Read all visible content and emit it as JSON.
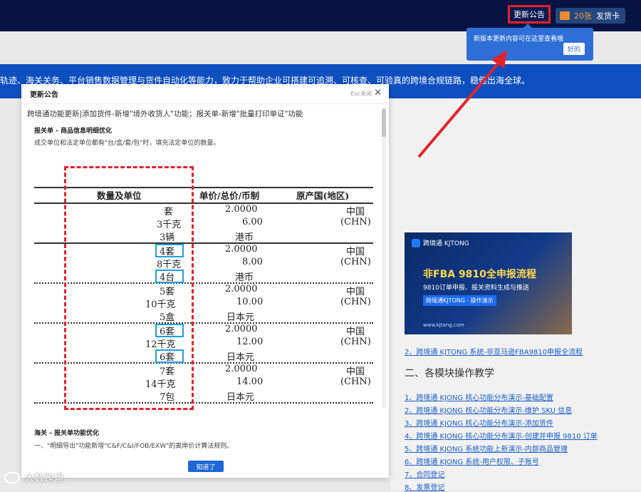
{
  "topbar": {
    "notice_label": "更新公告",
    "ticket_count": "20张",
    "ticket_label": "发货卡"
  },
  "tooltip": {
    "text": "新版本更新内容可在这里查看哦",
    "ok": "好的"
  },
  "banner": {
    "text": "轨迹、海关关务、平台销售数据管理与货件自动化等能力，致力于帮助企业可搭建可追溯、可核查、可验真的跨境合规链路，稳健出海全球。"
  },
  "dialog": {
    "title": "更新公告",
    "esc": "Esc关闭",
    "headline": "跨境通功能更新|添加货件-新增\"境外收货人\"功能；报关单-新增\"批量打印单证\"功能",
    "section1_title": "报关单 - 商品信息明细优化",
    "section1_desc": "成交单位和法定单位都有\"台/盒/套/包\"时，填充法定单位的数量。",
    "table": {
      "headers": [
        "数量及单位",
        "单价/总价/币制",
        "原产国(地区)"
      ],
      "groups": [
        {
          "qty": [
            "套",
            "3千克",
            "3辆"
          ],
          "price": [
            "2.0000",
            "6.00",
            "港币"
          ],
          "origin": [
            "中国",
            "(CHN)"
          ]
        },
        {
          "qty": [
            "4套",
            "8千克",
            "4台"
          ],
          "price": [
            "2.0000",
            "8.00",
            "港币"
          ],
          "origin": [
            "中国",
            "(CHN)"
          ]
        },
        {
          "qty": [
            "5套",
            "10千克",
            "5盒"
          ],
          "price": [
            "2.0000",
            "10.00",
            "日本元"
          ],
          "origin": [
            "中国",
            "(CHN)"
          ]
        },
        {
          "qty": [
            "6套",
            "12千克",
            "6套"
          ],
          "price": [
            "2.0000",
            "12.00",
            "日本元"
          ],
          "origin": [
            "中国",
            "(CHN)"
          ]
        },
        {
          "qty": [
            "7套",
            "14千克",
            "7包"
          ],
          "price": [
            "2.0000",
            "14.00",
            "日本元"
          ],
          "origin": [
            "中国",
            "(CHN)"
          ]
        }
      ]
    },
    "section2_title": "海关 - 报关单功能优化",
    "section2_desc": "一、\"明细导出\"功能新增\"C&F/C&I/FOB/EXW\"的离岸价计算法规则。",
    "confirm": "知道了"
  },
  "right": {
    "promo": {
      "brand": "跨境通 KJTONG",
      "title": "非FBA 9810全申报流程",
      "subtitle": "9810订单申报、报关资料生成与推送",
      "tag": "跨境通KJTONG · 操作演示",
      "site": "www.kjtong.com"
    },
    "promo_link": "2、跨境通 KJTONG 系统-非亚马逊FBA9810申报全流程",
    "section_title": "二、各模块操作教学",
    "links": [
      "1、跨境通 KJONG 核心功能分布演示-基础配置",
      "2、跨境通 KJONG 核心功能分布演示-维护 SKU 信息",
      "3、跨境通 KJONG 核心功能分布演示-添加货件",
      "4、跨境通 KJONG 核心功能分布演示-创建并申报 9810 订单",
      "5、跨境通 KJONG 系统功能上新演示-内部商品管理",
      "6、跨境通 KJONG 系统-用户权限、子账号",
      "7、合同登记",
      "8、发票登记"
    ]
  },
  "watermark": "大数跨境"
}
